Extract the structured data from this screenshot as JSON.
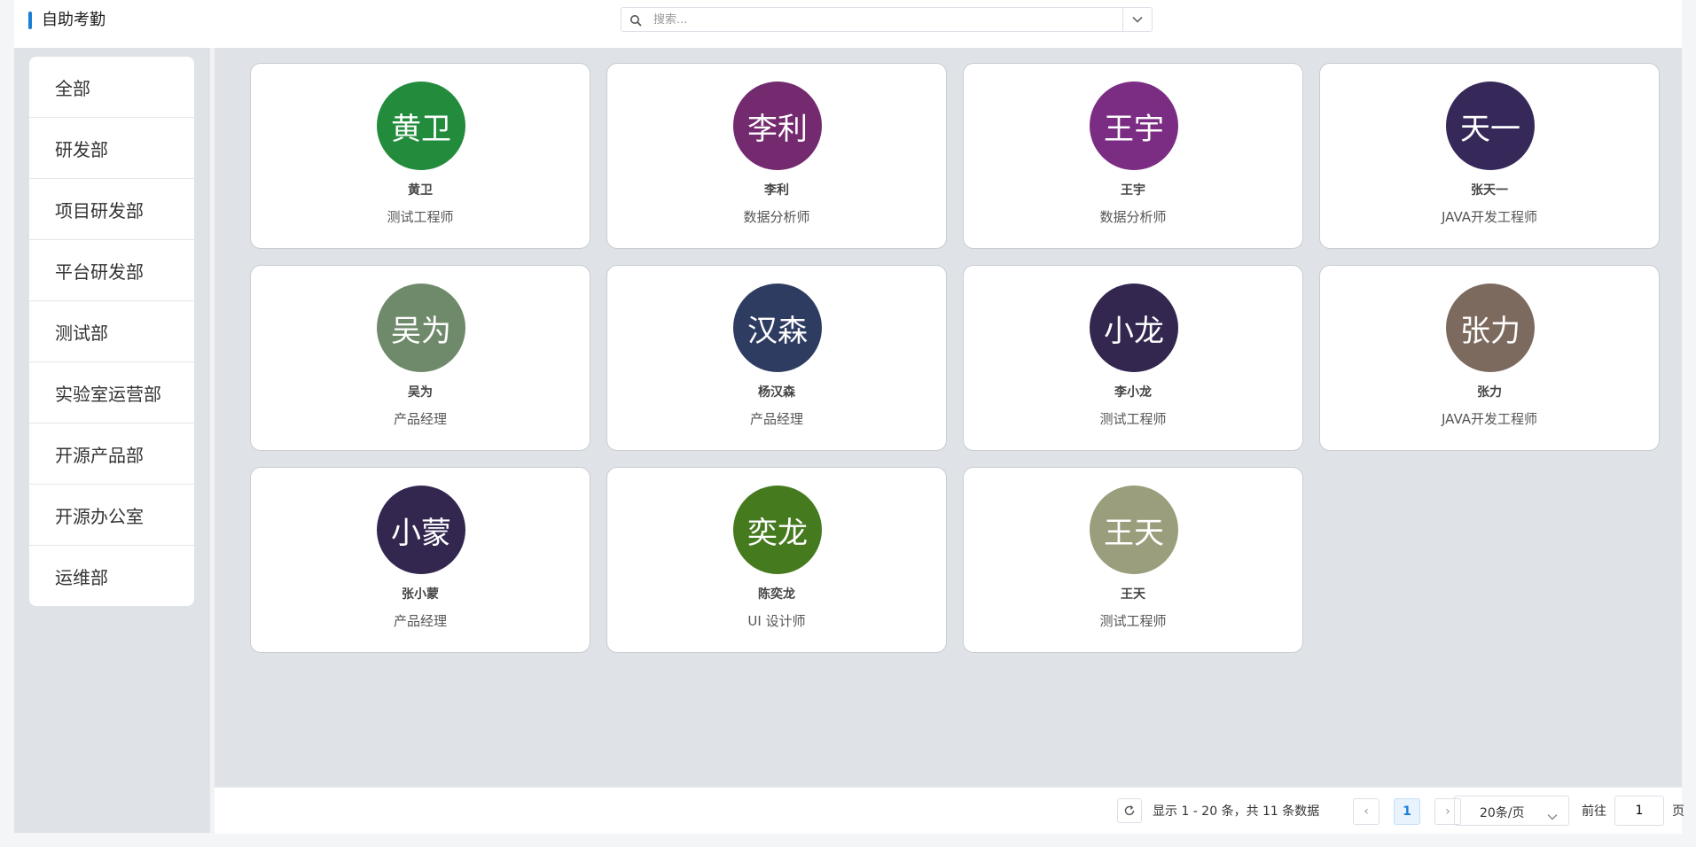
{
  "header": {
    "title": "自助考勤",
    "search_placeholder": "搜索..."
  },
  "sidebar": {
    "items": [
      "全部",
      "研发部",
      "项目研发部",
      "平台研发部",
      "测试部",
      "实验室运营部",
      "开源产品部",
      "开源办公室",
      "运维部"
    ]
  },
  "employees": [
    {
      "avatar_text": "黄卫",
      "name": "黄卫",
      "role": "测试工程师",
      "color": "#228b3c"
    },
    {
      "avatar_text": "李利",
      "name": "李利",
      "role": "数据分析师",
      "color": "#732a6e"
    },
    {
      "avatar_text": "王宇",
      "name": "王宇",
      "role": "数据分析师",
      "color": "#7b2d83"
    },
    {
      "avatar_text": "天一",
      "name": "张天一",
      "role": "JAVA开发工程师",
      "color": "#37285a"
    },
    {
      "avatar_text": "吴为",
      "name": "吴为",
      "role": "产品经理",
      "color": "#6f8a6a"
    },
    {
      "avatar_text": "汉森",
      "name": "杨汉森",
      "role": "产品经理",
      "color": "#2f3c62"
    },
    {
      "avatar_text": "小龙",
      "name": "李小龙",
      "role": "测试工程师",
      "color": "#33264f"
    },
    {
      "avatar_text": "张力",
      "name": "张力",
      "role": "JAVA开发工程师",
      "color": "#7d6a5f"
    },
    {
      "avatar_text": "小蒙",
      "name": "张小蒙",
      "role": "产品经理",
      "color": "#332750"
    },
    {
      "avatar_text": "奕龙",
      "name": "陈奕龙",
      "role": "UI 设计师",
      "color": "#467a1f"
    },
    {
      "avatar_text": "王天",
      "name": "王天",
      "role": "测试工程师",
      "color": "#9a9e7c"
    }
  ],
  "pagination": {
    "info": "显示 1 - 20 条，共 11 条数据",
    "prev": "‹",
    "current_page": "1",
    "next": "›",
    "page_size": "20条/页",
    "goto_label": "前往",
    "goto_value": "1",
    "goto_unit": "页"
  },
  "colors": {
    "accent": "#1a7fd6",
    "panel_bg": "#dfe3e7"
  },
  "icons": {
    "search": "search-icon",
    "dropdown": "chevron-down-icon",
    "refresh": "refresh-icon"
  }
}
